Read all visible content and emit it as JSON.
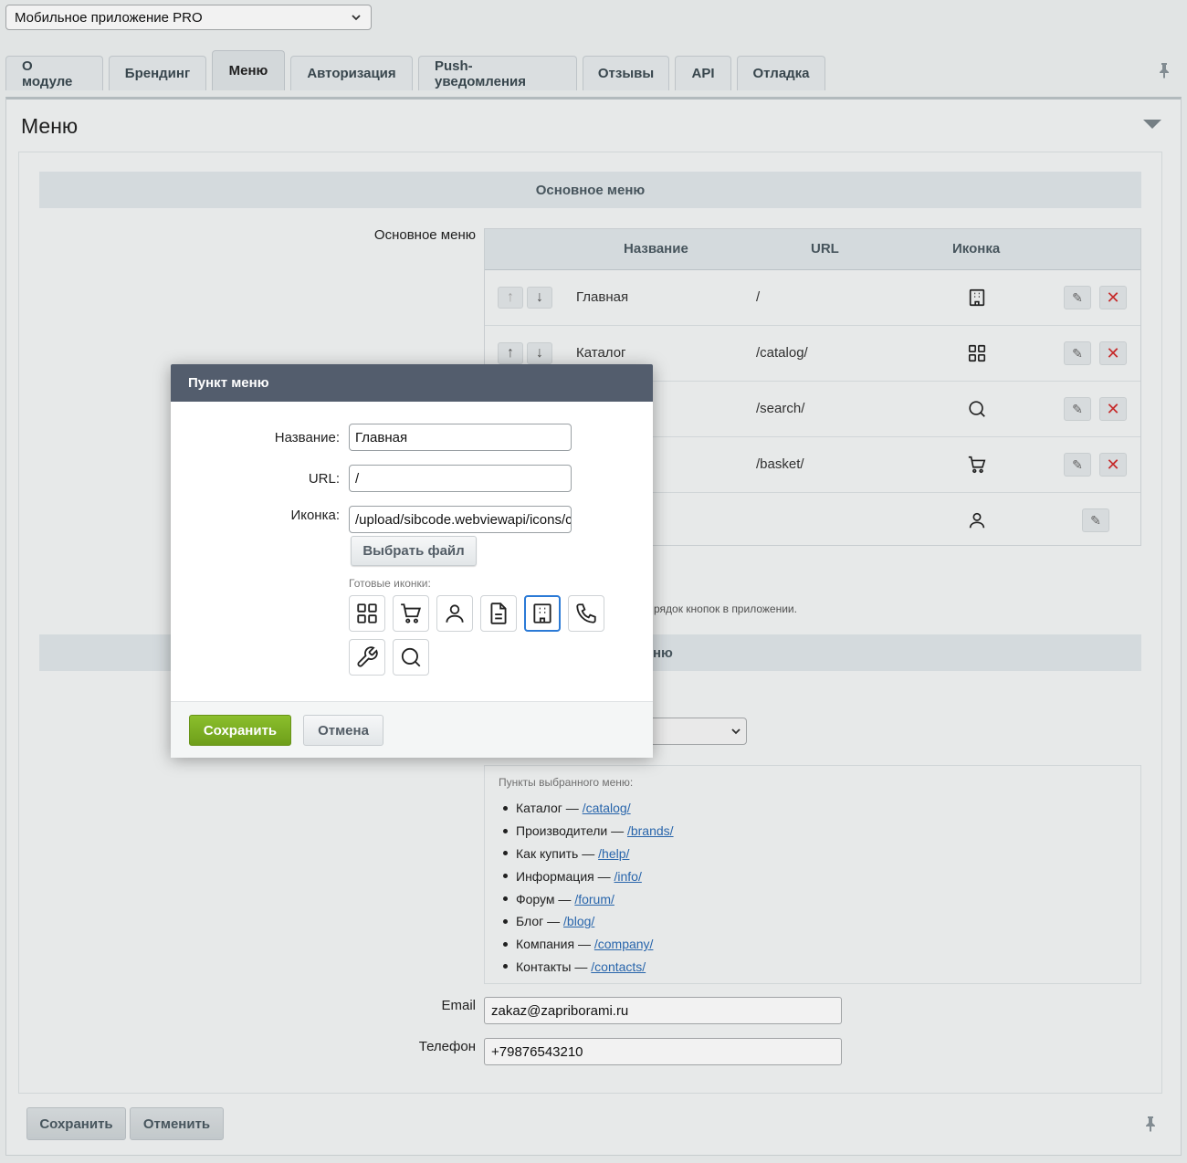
{
  "module_select": {
    "value": "Мобильное приложение PRO"
  },
  "tabs": [
    {
      "label": "О модуле"
    },
    {
      "label": "Брендинг"
    },
    {
      "label": "Меню",
      "active": true
    },
    {
      "label": "Авторизация"
    },
    {
      "label": "Push-уведомления"
    },
    {
      "label": "Отзывы"
    },
    {
      "label": "API"
    },
    {
      "label": "Отладка"
    }
  ],
  "panel": {
    "title": "Меню"
  },
  "main_menu_section": {
    "header": "Основное меню",
    "field_label": "Основное меню",
    "columns": {
      "name": "Название",
      "url": "URL",
      "icon": "Иконка"
    },
    "rows": [
      {
        "name": "Главная",
        "url": "/",
        "icon": "building-icon"
      },
      {
        "name": "Каталог",
        "url": "/catalog/",
        "icon": "grid-icon"
      },
      {
        "name": "",
        "url": "/search/",
        "icon": "search-icon"
      },
      {
        "name": "",
        "url": "/basket/",
        "icon": "cart-icon"
      },
      {
        "name": "",
        "url": "",
        "icon": "user-icon"
      }
    ],
    "hint_fragment": "рядок кнопок в приложении."
  },
  "second_section": {
    "header_fragment": "ню"
  },
  "selected_menu": {
    "caption": "Пункты выбранного меню:",
    "items": [
      {
        "name": "Каталог",
        "sep": " — ",
        "url": "/catalog/"
      },
      {
        "name": "Производители",
        "sep": " — ",
        "url": "/brands/"
      },
      {
        "name": "Как купить",
        "sep": " — ",
        "url": "/help/"
      },
      {
        "name": "Информация",
        "sep": " — ",
        "url": "/info/"
      },
      {
        "name": "Форум",
        "sep": " — ",
        "url": "/forum/"
      },
      {
        "name": "Блог",
        "sep": " — ",
        "url": "/blog/"
      },
      {
        "name": "Компания",
        "sep": " — ",
        "url": "/company/"
      },
      {
        "name": "Контакты",
        "sep": " — ",
        "url": "/contacts/"
      }
    ]
  },
  "contacts": {
    "email_label": "Email",
    "email_value": "zakaz@zapriborami.ru",
    "phone_label": "Телефон",
    "phone_value": "+79876543210"
  },
  "footer": {
    "save": "Сохранить",
    "cancel": "Отменить"
  },
  "modal": {
    "title": "Пункт меню",
    "name_label": "Название:",
    "name_value": "Главная",
    "url_label": "URL:",
    "url_value": "/",
    "icon_label": "Иконка:",
    "icon_value": "/upload/sibcode.webviewapi/icons/c",
    "file_button": "Выбрать файл",
    "ready_icons_caption": "Готовые иконки:",
    "ready_icons": [
      "grid-icon",
      "cart-icon",
      "user-icon",
      "document-icon",
      "building-icon",
      "phone-icon",
      "wrench-icon",
      "search-icon"
    ],
    "selected_icon": "building-icon",
    "save": "Сохранить",
    "cancel": "Отмена"
  },
  "colors": {
    "accent_green": "#7aac22",
    "modal_header": "#535d6d",
    "selected_icon_border": "#2b7ad6",
    "delete_red": "#d12d2d"
  }
}
